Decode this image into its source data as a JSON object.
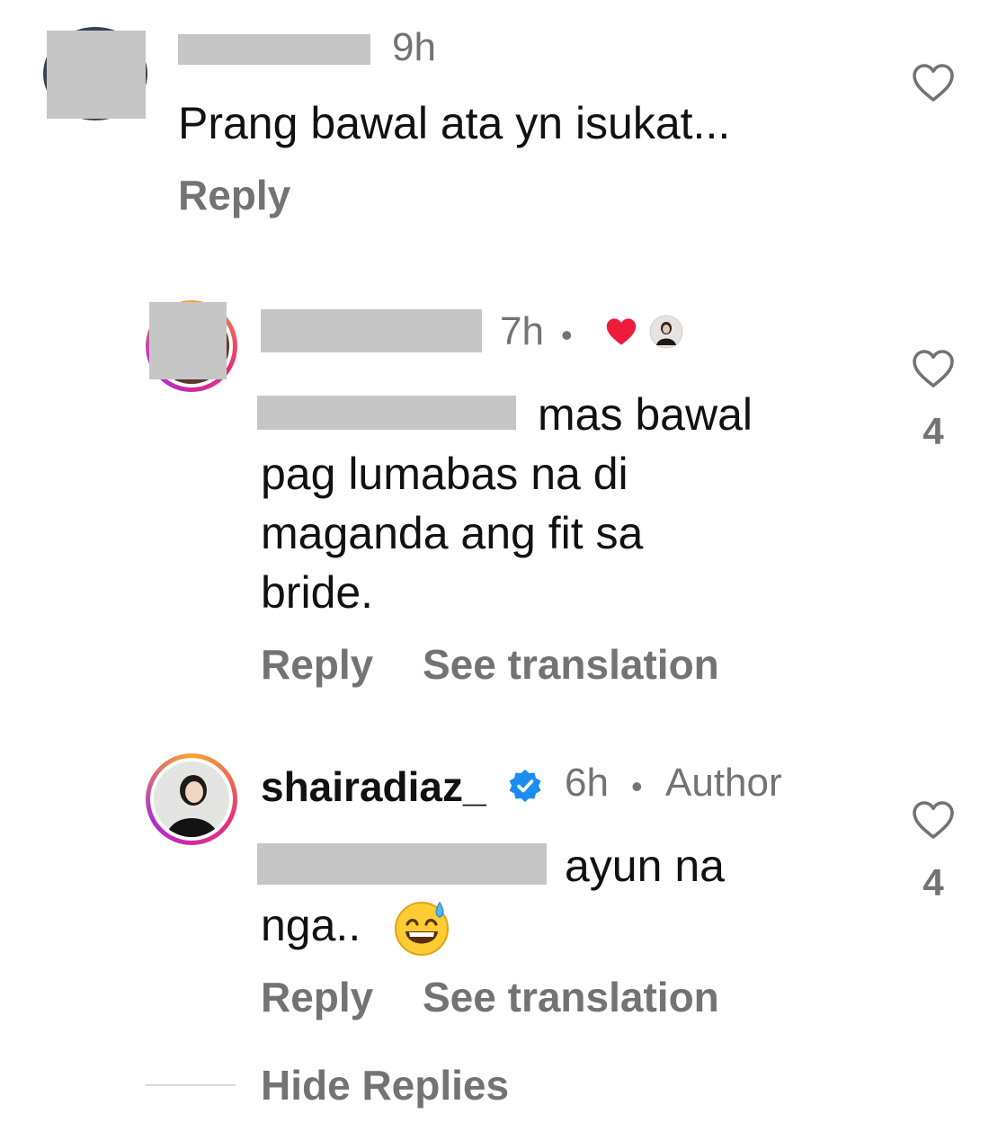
{
  "comments": [
    {
      "time": "9h",
      "text": "Prang bawal ata yn isukat...",
      "reply_label": "Reply"
    },
    {
      "time": "7h",
      "separator": "•",
      "text_line1_tail": "mas bawal",
      "text_line2": "pag lumabas na di",
      "text_line3": "maganda ang fit sa",
      "text_line4": "bride.",
      "reply_label": "Reply",
      "translate_label": "See translation",
      "like_count": "4",
      "liked_by_author_icon": "heart-red"
    },
    {
      "username": "shairadiaz_",
      "verified_icon": "verified-badge-icon",
      "time": "6h",
      "separator": "•",
      "author_label": "Author",
      "text_line1_tail": "ayun na",
      "text_line2": "nga..",
      "emoji": "😅",
      "reply_label": "Reply",
      "translate_label": "See translation",
      "like_count": "4"
    }
  ],
  "hide_replies_label": "Hide Replies",
  "colors": {
    "secondary_text": "#737373",
    "heart_red": "#ed1c3a",
    "verified_blue": "#1d8cf0",
    "redaction_gray": "#c6c6c6"
  }
}
